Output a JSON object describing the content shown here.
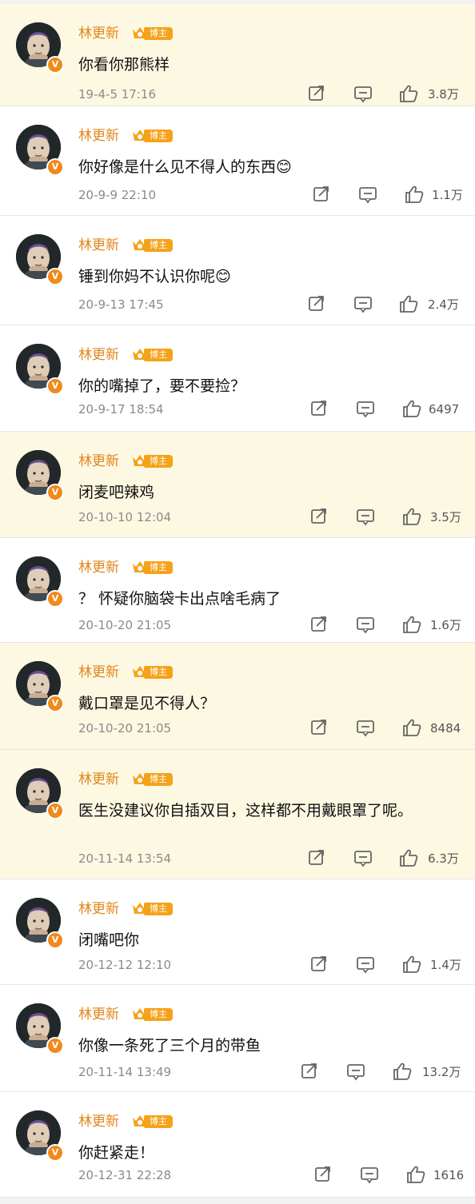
{
  "username": "林更新",
  "badge_label": "博主",
  "avatar_badge": "V",
  "colors": {
    "highlight_bg": "#fdf8e2",
    "name": "#e2851a",
    "badge": "#f5a21b",
    "icon": "#666666"
  },
  "icons": {
    "repost": "repost-icon",
    "comment": "comment-icon",
    "like": "thumbs-up-icon"
  },
  "comments": [
    {
      "text": "你看你那熊样",
      "time": "19-4-5 17:16",
      "likes": "3.8万"
    },
    {
      "text": "你好像是什么见不得人的东西😊",
      "time": "20-9-9 22:10",
      "likes": "1.1万"
    },
    {
      "text": "锤到你妈不认识你呢😊",
      "time": "20-9-13 17:45",
      "likes": "2.4万"
    },
    {
      "text": "你的嘴掉了，要不要捡？",
      "time": "20-9-17 18:54",
      "likes": "6497"
    },
    {
      "text": "闭麦吧辣鸡",
      "time": "20-10-10 12:04",
      "likes": "3.5万"
    },
    {
      "text": "？ 怀疑你脑袋卡出点啥毛病了",
      "time": "20-10-20 21:05",
      "likes": "1.6万"
    },
    {
      "text": "戴口罩是见不得人？",
      "time": "20-10-20 21:05",
      "likes": "8484"
    },
    {
      "text": "医生没建议你自插双目，这样都不用戴眼罩了呢。",
      "time": "20-11-14 13:54",
      "likes": "6.3万"
    },
    {
      "text": "闭嘴吧你",
      "time": "20-12-12 12:10",
      "likes": "1.4万"
    },
    {
      "text": "你像一条死了三个月的带鱼",
      "time": "20-11-14 13:49",
      "likes": "13.2万"
    },
    {
      "text": "你赶紧走！",
      "time": "20-12-31 22:28",
      "likes": "1616"
    }
  ]
}
